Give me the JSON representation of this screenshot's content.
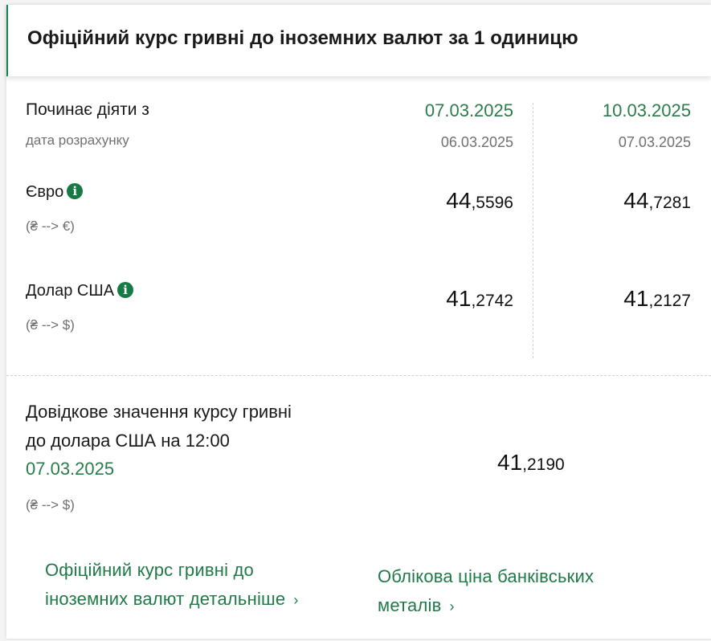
{
  "title": "Офіційний курс гривні до іноземних валют за 1 одиницю",
  "effective_label": "Починає діяти з",
  "calc_label": "дата розрахунку",
  "columns": [
    {
      "date": "07.03.2025",
      "calc_date": "06.03.2025"
    },
    {
      "date": "10.03.2025",
      "calc_date": "07.03.2025"
    }
  ],
  "currencies": [
    {
      "name": "Євро",
      "direction": "(₴ --> €)",
      "rates": [
        {
          "int": "44",
          "frac": ",5596"
        },
        {
          "int": "44",
          "frac": ",7281"
        }
      ]
    },
    {
      "name": "Долар США",
      "direction": "(₴ --> $)",
      "rates": [
        {
          "int": "41",
          "frac": ",2742"
        },
        {
          "int": "41",
          "frac": ",2127"
        }
      ]
    }
  ],
  "reference": {
    "line1": "Довідкове значення курсу гривні",
    "line2": "до долара США на 12:00",
    "date": "07.03.2025",
    "direction": "(₴ --> $)",
    "int": "41",
    "frac": ",2190"
  },
  "links": {
    "detailed_line1": "Офіційний курс гривні до",
    "detailed_line2": "іноземних валют детальніше",
    "metals_line1": "Облікова ціна банківських",
    "metals_line2": "металів",
    "chevron": "›"
  },
  "info_icon_glyph": "i",
  "colors": {
    "accent": "#2a7d4a",
    "info_bg": "#157a43"
  }
}
